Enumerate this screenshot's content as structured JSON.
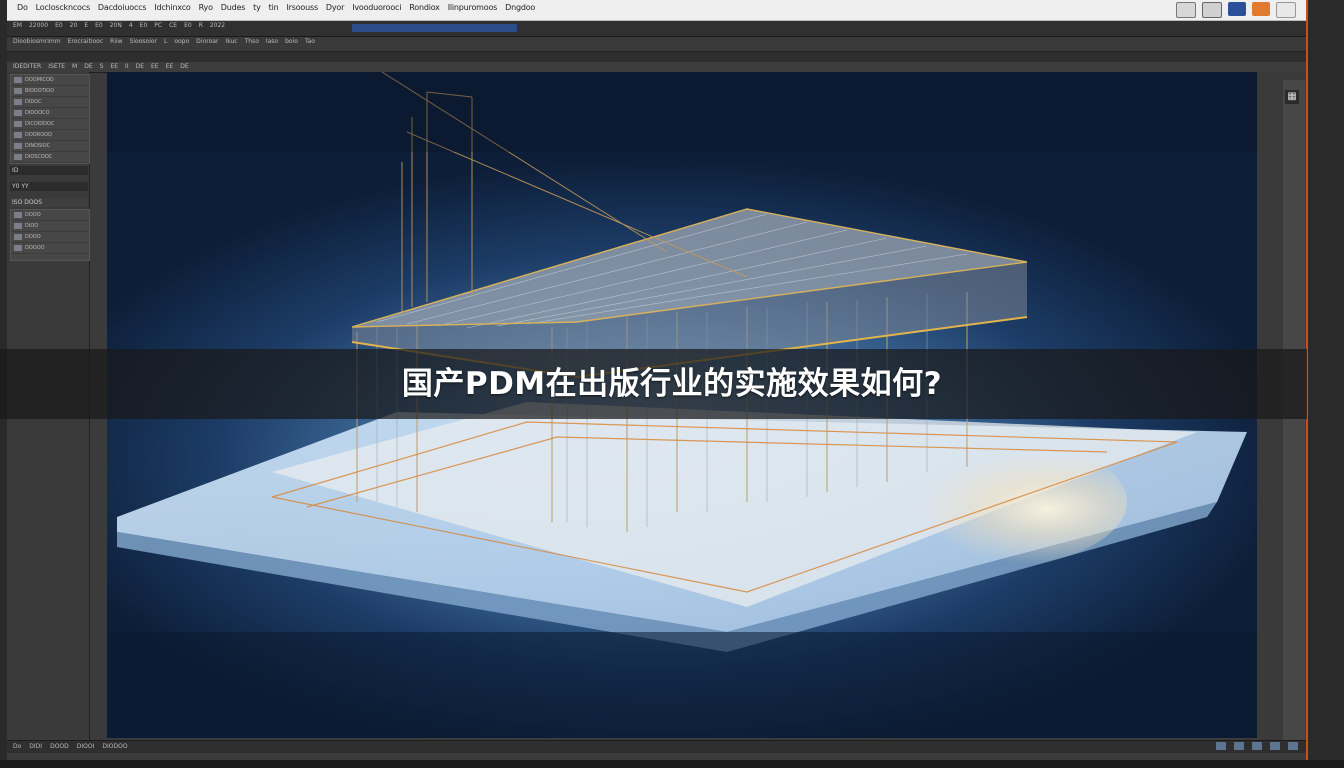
{
  "menubar": {
    "items": [
      "Do",
      "Loclosckncocs",
      "Dacdoiuoccs",
      "Idchinxco",
      "Ryo",
      "Dudes",
      "ty",
      "tin",
      "Irsoouss",
      "Dyor",
      "Ivooduorooci",
      "Rondiox",
      "Ilinpuromoos",
      "Dngdoo"
    ]
  },
  "toolbar1": {
    "items": [
      "EM",
      "22000",
      "E0",
      "20",
      "E",
      "E0",
      "20N",
      "4",
      "E0",
      "PC",
      "CE",
      "E0",
      "R",
      "2022"
    ]
  },
  "toolbar2": {
    "items": [
      "Dioobiosmrimm",
      "Erocraitiooc",
      "Riiw",
      "Sioosoior",
      "L",
      "oopo",
      "Dinroar",
      "Ikuc",
      "Thso",
      "Iaso",
      "boio",
      "Tao"
    ]
  },
  "toolbar4": {
    "items": [
      "IDEDITER",
      "ISETE",
      "M",
      "DE",
      "S",
      "EE",
      "II",
      "DE",
      "EE",
      "EE",
      "DE"
    ]
  },
  "left_panel": {
    "section1_rows": [
      "DOOMICOD",
      "BIODOTIOO",
      "DIDOC",
      "DIOOOCO",
      "DICOIDDOC",
      "DOOROOD",
      "DINOSIOC",
      "DIOSCOOC"
    ],
    "section2_title": "ID",
    "section3_title": "Y0 YY",
    "section4_title": "ISO DOOS",
    "section4_rows": [
      "DOOO",
      "DIOO",
      "DOOO",
      "DOOOO"
    ]
  },
  "status": {
    "items": [
      "Do",
      "DIDI",
      "DOOD",
      "DIOOI",
      "DIODOO"
    ]
  },
  "banner": {
    "title": "国产PDM在出版行业的实施效果如何?"
  },
  "colors": {
    "accent": "#c0541c",
    "viewport_blue": "#1c3c66",
    "wire_gold": "#d9a441"
  },
  "icons": [
    "bucket-icon",
    "align-icon",
    "grid-icon",
    "window-icon",
    "layout-icon",
    "panel-toggle-icon"
  ]
}
